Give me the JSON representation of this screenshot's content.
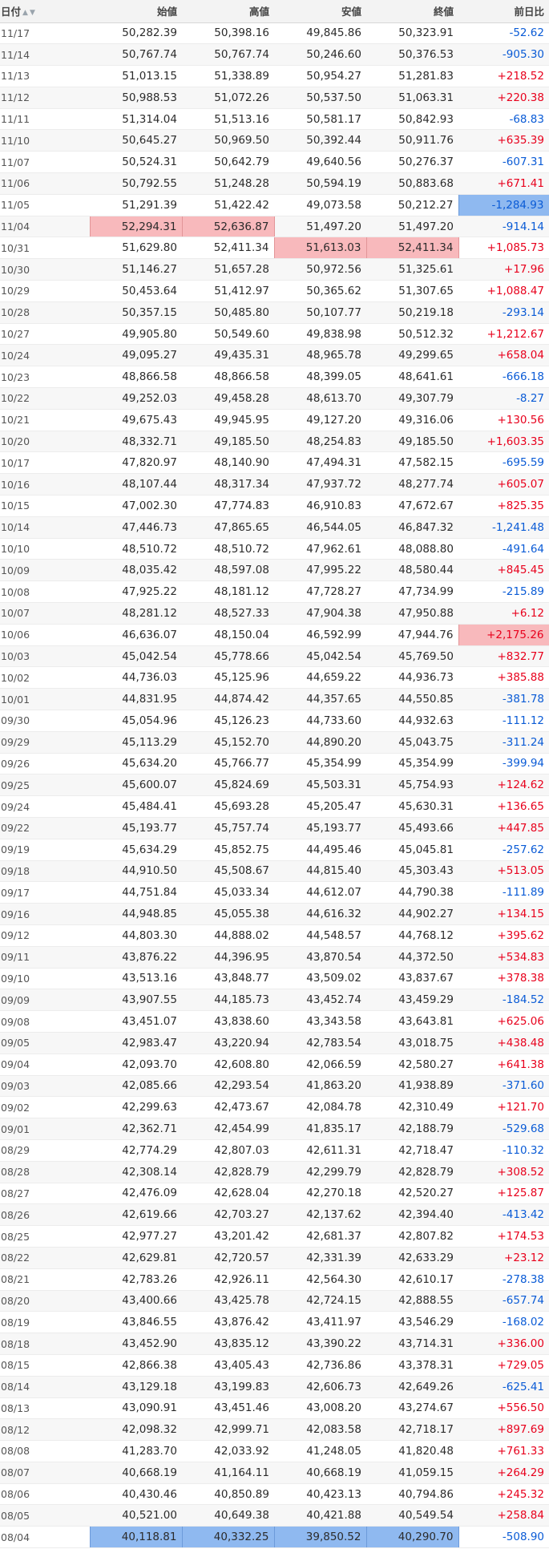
{
  "table": {
    "headers": {
      "date": "日付",
      "open": "始値",
      "high": "高値",
      "low": "安値",
      "close": "終値",
      "change": "前日比"
    },
    "sort_icons": {
      "up": "▲",
      "down": "▼"
    },
    "highlight_colors": {
      "max": "#f8b9bc",
      "min": "#8fb9f0",
      "positive_text": "#e8001c",
      "negative_text": "#0a5bd6"
    },
    "rows": [
      {
        "date": "11/17",
        "open": "50,282.39",
        "high": "50,398.16",
        "low": "49,845.86",
        "close": "50,323.91",
        "change": "-52.62"
      },
      {
        "date": "11/14",
        "open": "50,767.74",
        "high": "50,767.74",
        "low": "50,246.60",
        "close": "50,376.53",
        "change": "-905.30"
      },
      {
        "date": "11/13",
        "open": "51,013.15",
        "high": "51,338.89",
        "low": "50,954.27",
        "close": "51,281.83",
        "change": "+218.52"
      },
      {
        "date": "11/12",
        "open": "50,988.53",
        "high": "51,072.26",
        "low": "50,537.50",
        "close": "51,063.31",
        "change": "+220.38"
      },
      {
        "date": "11/11",
        "open": "51,314.04",
        "high": "51,513.16",
        "low": "50,581.17",
        "close": "50,842.93",
        "change": "-68.83"
      },
      {
        "date": "11/10",
        "open": "50,645.27",
        "high": "50,969.50",
        "low": "50,392.44",
        "close": "50,911.76",
        "change": "+635.39"
      },
      {
        "date": "11/07",
        "open": "50,524.31",
        "high": "50,642.79",
        "low": "49,640.56",
        "close": "50,276.37",
        "change": "-607.31"
      },
      {
        "date": "11/06",
        "open": "50,792.55",
        "high": "51,248.28",
        "low": "50,594.19",
        "close": "50,883.68",
        "change": "+671.41"
      },
      {
        "date": "11/05",
        "open": "51,291.39",
        "high": "51,422.42",
        "low": "49,073.58",
        "close": "50,212.27",
        "change": "-1,284.93",
        "hl": {
          "change": "min"
        }
      },
      {
        "date": "11/04",
        "open": "52,294.31",
        "high": "52,636.87",
        "low": "51,497.20",
        "close": "51,497.20",
        "change": "-914.14",
        "hl": {
          "open": "max",
          "high": "max"
        }
      },
      {
        "date": "10/31",
        "open": "51,629.80",
        "high": "52,411.34",
        "low": "51,613.03",
        "close": "52,411.34",
        "change": "+1,085.73",
        "hl": {
          "low": "max",
          "close": "max"
        }
      },
      {
        "date": "10/30",
        "open": "51,146.27",
        "high": "51,657.28",
        "low": "50,972.56",
        "close": "51,325.61",
        "change": "+17.96"
      },
      {
        "date": "10/29",
        "open": "50,453.64",
        "high": "51,412.97",
        "low": "50,365.62",
        "close": "51,307.65",
        "change": "+1,088.47"
      },
      {
        "date": "10/28",
        "open": "50,357.15",
        "high": "50,485.80",
        "low": "50,107.77",
        "close": "50,219.18",
        "change": "-293.14"
      },
      {
        "date": "10/27",
        "open": "49,905.80",
        "high": "50,549.60",
        "low": "49,838.98",
        "close": "50,512.32",
        "change": "+1,212.67"
      },
      {
        "date": "10/24",
        "open": "49,095.27",
        "high": "49,435.31",
        "low": "48,965.78",
        "close": "49,299.65",
        "change": "+658.04"
      },
      {
        "date": "10/23",
        "open": "48,866.58",
        "high": "48,866.58",
        "low": "48,399.05",
        "close": "48,641.61",
        "change": "-666.18"
      },
      {
        "date": "10/22",
        "open": "49,252.03",
        "high": "49,458.28",
        "low": "48,613.70",
        "close": "49,307.79",
        "change": "-8.27"
      },
      {
        "date": "10/21",
        "open": "49,675.43",
        "high": "49,945.95",
        "low": "49,127.20",
        "close": "49,316.06",
        "change": "+130.56"
      },
      {
        "date": "10/20",
        "open": "48,332.71",
        "high": "49,185.50",
        "low": "48,254.83",
        "close": "49,185.50",
        "change": "+1,603.35"
      },
      {
        "date": "10/17",
        "open": "47,820.97",
        "high": "48,140.90",
        "low": "47,494.31",
        "close": "47,582.15",
        "change": "-695.59"
      },
      {
        "date": "10/16",
        "open": "48,107.44",
        "high": "48,317.34",
        "low": "47,937.72",
        "close": "48,277.74",
        "change": "+605.07"
      },
      {
        "date": "10/15",
        "open": "47,002.30",
        "high": "47,774.83",
        "low": "46,910.83",
        "close": "47,672.67",
        "change": "+825.35"
      },
      {
        "date": "10/14",
        "open": "47,446.73",
        "high": "47,865.65",
        "low": "46,544.05",
        "close": "46,847.32",
        "change": "-1,241.48"
      },
      {
        "date": "10/10",
        "open": "48,510.72",
        "high": "48,510.72",
        "low": "47,962.61",
        "close": "48,088.80",
        "change": "-491.64"
      },
      {
        "date": "10/09",
        "open": "48,035.42",
        "high": "48,597.08",
        "low": "47,995.22",
        "close": "48,580.44",
        "change": "+845.45"
      },
      {
        "date": "10/08",
        "open": "47,925.22",
        "high": "48,181.12",
        "low": "47,728.27",
        "close": "47,734.99",
        "change": "-215.89"
      },
      {
        "date": "10/07",
        "open": "48,281.12",
        "high": "48,527.33",
        "low": "47,904.38",
        "close": "47,950.88",
        "change": "+6.12"
      },
      {
        "date": "10/06",
        "open": "46,636.07",
        "high": "48,150.04",
        "low": "46,592.99",
        "close": "47,944.76",
        "change": "+2,175.26",
        "hl": {
          "change": "max"
        }
      },
      {
        "date": "10/03",
        "open": "45,042.54",
        "high": "45,778.66",
        "low": "45,042.54",
        "close": "45,769.50",
        "change": "+832.77"
      },
      {
        "date": "10/02",
        "open": "44,736.03",
        "high": "45,125.96",
        "low": "44,659.22",
        "close": "44,936.73",
        "change": "+385.88"
      },
      {
        "date": "10/01",
        "open": "44,831.95",
        "high": "44,874.42",
        "low": "44,357.65",
        "close": "44,550.85",
        "change": "-381.78"
      },
      {
        "date": "09/30",
        "open": "45,054.96",
        "high": "45,126.23",
        "low": "44,733.60",
        "close": "44,932.63",
        "change": "-111.12"
      },
      {
        "date": "09/29",
        "open": "45,113.29",
        "high": "45,152.70",
        "low": "44,890.20",
        "close": "45,043.75",
        "change": "-311.24"
      },
      {
        "date": "09/26",
        "open": "45,634.20",
        "high": "45,766.77",
        "low": "45,354.99",
        "close": "45,354.99",
        "change": "-399.94"
      },
      {
        "date": "09/25",
        "open": "45,600.07",
        "high": "45,824.69",
        "low": "45,503.31",
        "close": "45,754.93",
        "change": "+124.62"
      },
      {
        "date": "09/24",
        "open": "45,484.41",
        "high": "45,693.28",
        "low": "45,205.47",
        "close": "45,630.31",
        "change": "+136.65"
      },
      {
        "date": "09/22",
        "open": "45,193.77",
        "high": "45,757.74",
        "low": "45,193.77",
        "close": "45,493.66",
        "change": "+447.85"
      },
      {
        "date": "09/19",
        "open": "45,634.29",
        "high": "45,852.75",
        "low": "44,495.46",
        "close": "45,045.81",
        "change": "-257.62"
      },
      {
        "date": "09/18",
        "open": "44,910.50",
        "high": "45,508.67",
        "low": "44,815.40",
        "close": "45,303.43",
        "change": "+513.05"
      },
      {
        "date": "09/17",
        "open": "44,751.84",
        "high": "45,033.34",
        "low": "44,612.07",
        "close": "44,790.38",
        "change": "-111.89"
      },
      {
        "date": "09/16",
        "open": "44,948.85",
        "high": "45,055.38",
        "low": "44,616.32",
        "close": "44,902.27",
        "change": "+134.15"
      },
      {
        "date": "09/12",
        "open": "44,803.30",
        "high": "44,888.02",
        "low": "44,548.57",
        "close": "44,768.12",
        "change": "+395.62"
      },
      {
        "date": "09/11",
        "open": "43,876.22",
        "high": "44,396.95",
        "low": "43,870.54",
        "close": "44,372.50",
        "change": "+534.83"
      },
      {
        "date": "09/10",
        "open": "43,513.16",
        "high": "43,848.77",
        "low": "43,509.02",
        "close": "43,837.67",
        "change": "+378.38"
      },
      {
        "date": "09/09",
        "open": "43,907.55",
        "high": "44,185.73",
        "low": "43,452.74",
        "close": "43,459.29",
        "change": "-184.52"
      },
      {
        "date": "09/08",
        "open": "43,451.07",
        "high": "43,838.60",
        "low": "43,343.58",
        "close": "43,643.81",
        "change": "+625.06"
      },
      {
        "date": "09/05",
        "open": "42,983.47",
        "high": "43,220.94",
        "low": "42,783.54",
        "close": "43,018.75",
        "change": "+438.48"
      },
      {
        "date": "09/04",
        "open": "42,093.70",
        "high": "42,608.80",
        "low": "42,066.59",
        "close": "42,580.27",
        "change": "+641.38"
      },
      {
        "date": "09/03",
        "open": "42,085.66",
        "high": "42,293.54",
        "low": "41,863.20",
        "close": "41,938.89",
        "change": "-371.60"
      },
      {
        "date": "09/02",
        "open": "42,299.63",
        "high": "42,473.67",
        "low": "42,084.78",
        "close": "42,310.49",
        "change": "+121.70"
      },
      {
        "date": "09/01",
        "open": "42,362.71",
        "high": "42,454.99",
        "low": "41,835.17",
        "close": "42,188.79",
        "change": "-529.68"
      },
      {
        "date": "08/29",
        "open": "42,774.29",
        "high": "42,807.03",
        "low": "42,611.31",
        "close": "42,718.47",
        "change": "-110.32"
      },
      {
        "date": "08/28",
        "open": "42,308.14",
        "high": "42,828.79",
        "low": "42,299.79",
        "close": "42,828.79",
        "change": "+308.52"
      },
      {
        "date": "08/27",
        "open": "42,476.09",
        "high": "42,628.04",
        "low": "42,270.18",
        "close": "42,520.27",
        "change": "+125.87"
      },
      {
        "date": "08/26",
        "open": "42,619.66",
        "high": "42,703.27",
        "low": "42,137.62",
        "close": "42,394.40",
        "change": "-413.42"
      },
      {
        "date": "08/25",
        "open": "42,977.27",
        "high": "43,201.42",
        "low": "42,681.37",
        "close": "42,807.82",
        "change": "+174.53"
      },
      {
        "date": "08/22",
        "open": "42,629.81",
        "high": "42,720.57",
        "low": "42,331.39",
        "close": "42,633.29",
        "change": "+23.12"
      },
      {
        "date": "08/21",
        "open": "42,783.26",
        "high": "42,926.11",
        "low": "42,564.30",
        "close": "42,610.17",
        "change": "-278.38"
      },
      {
        "date": "08/20",
        "open": "43,400.66",
        "high": "43,425.78",
        "low": "42,724.15",
        "close": "42,888.55",
        "change": "-657.74"
      },
      {
        "date": "08/19",
        "open": "43,846.55",
        "high": "43,876.42",
        "low": "43,411.97",
        "close": "43,546.29",
        "change": "-168.02"
      },
      {
        "date": "08/18",
        "open": "43,452.90",
        "high": "43,835.12",
        "low": "43,390.22",
        "close": "43,714.31",
        "change": "+336.00"
      },
      {
        "date": "08/15",
        "open": "42,866.38",
        "high": "43,405.43",
        "low": "42,736.86",
        "close": "43,378.31",
        "change": "+729.05"
      },
      {
        "date": "08/14",
        "open": "43,129.18",
        "high": "43,199.83",
        "low": "42,606.73",
        "close": "42,649.26",
        "change": "-625.41"
      },
      {
        "date": "08/13",
        "open": "43,090.91",
        "high": "43,451.46",
        "low": "43,008.20",
        "close": "43,274.67",
        "change": "+556.50"
      },
      {
        "date": "08/12",
        "open": "42,098.32",
        "high": "42,999.71",
        "low": "42,083.58",
        "close": "42,718.17",
        "change": "+897.69"
      },
      {
        "date": "08/08",
        "open": "41,283.70",
        "high": "42,033.92",
        "low": "41,248.05",
        "close": "41,820.48",
        "change": "+761.33"
      },
      {
        "date": "08/07",
        "open": "40,668.19",
        "high": "41,164.11",
        "low": "40,668.19",
        "close": "41,059.15",
        "change": "+264.29"
      },
      {
        "date": "08/06",
        "open": "40,430.46",
        "high": "40,850.89",
        "low": "40,423.13",
        "close": "40,794.86",
        "change": "+245.32"
      },
      {
        "date": "08/05",
        "open": "40,521.00",
        "high": "40,649.38",
        "low": "40,421.88",
        "close": "40,549.54",
        "change": "+258.84"
      },
      {
        "date": "08/04",
        "open": "40,118.81",
        "high": "40,332.25",
        "low": "39,850.52",
        "close": "40,290.70",
        "change": "-508.90",
        "hl": {
          "open": "min",
          "high": "min",
          "low": "min",
          "close": "min"
        }
      }
    ]
  }
}
